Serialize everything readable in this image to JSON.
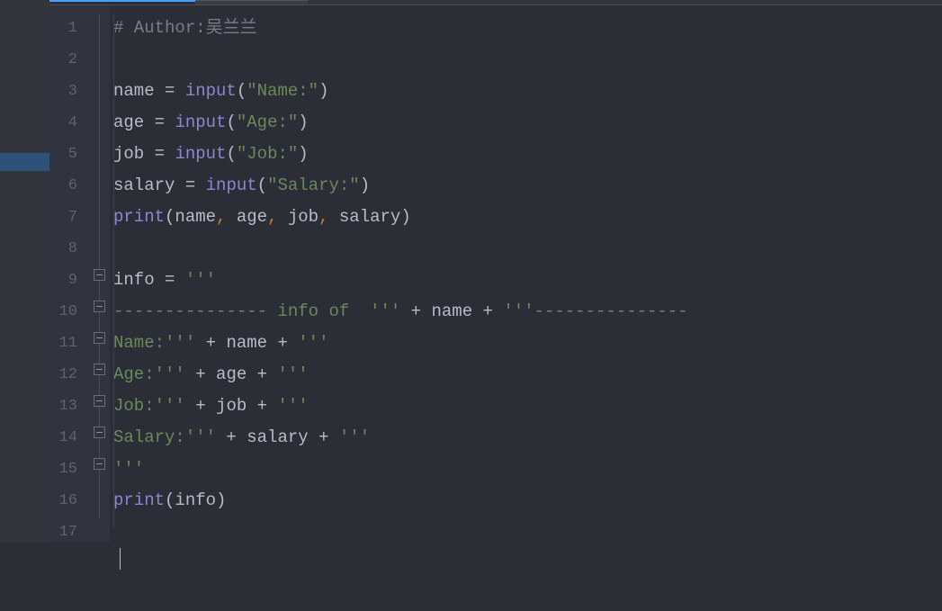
{
  "tabs": {
    "active": "",
    "inactive": ""
  },
  "lineNumbers": [
    "1",
    "2",
    "3",
    "4",
    "5",
    "6",
    "7",
    "8",
    "9",
    "10",
    "11",
    "12",
    "13",
    "14",
    "15",
    "16",
    "17"
  ],
  "code": {
    "line1": {
      "comment": "# Author:吴兰兰"
    },
    "line2": {},
    "line3": {
      "var": "name",
      "op": " = ",
      "fn": "input",
      "p1": "(",
      "str": "\"Name:\"",
      "p2": ")"
    },
    "line4": {
      "var": "age",
      "op": " = ",
      "fn": "input",
      "p1": "(",
      "str": "\"Age:\"",
      "p2": ")"
    },
    "line5": {
      "var": "job",
      "op": " = ",
      "fn": "input",
      "p1": "(",
      "str": "\"Job:\"",
      "p2": ")"
    },
    "line6": {
      "var": "salary",
      "op": " = ",
      "fn": "input",
      "p1": "(",
      "str": "\"Salary:\"",
      "p2": ")"
    },
    "line7": {
      "fn": "print",
      "p1": "(",
      "a1": "name",
      "c1": ",",
      "sp1": " ",
      "a2": "age",
      "c2": ",",
      "sp2": " ",
      "a3": "job",
      "c3": ",",
      "sp3": " ",
      "a4": "salary",
      "p2": ")"
    },
    "line8": {},
    "line9": {
      "var": "info",
      "op": " = ",
      "str": "'''"
    },
    "line10": {
      "s1": "--------------- info of  '''",
      "op1": " + ",
      "v1": "name",
      "op2": " + ",
      "s2": "'''---------------"
    },
    "line11": {
      "s1": "Name:'''",
      "op1": " + ",
      "v1": "name",
      "op2": " + ",
      "s2": "'''"
    },
    "line12": {
      "s1": "Age:'''",
      "op1": " + ",
      "v1": "age",
      "op2": " + ",
      "s2": "'''"
    },
    "line13": {
      "s1": "Job:'''",
      "op1": " + ",
      "v1": "job",
      "op2": " + ",
      "s2": "'''"
    },
    "line14": {
      "s1": "Salary:'''",
      "op1": " + ",
      "v1": "salary",
      "op2": " + ",
      "s2": "'''"
    },
    "line15": {
      "s1": "'''"
    },
    "line16": {
      "fn": "print",
      "p1": "(",
      "a1": "info",
      "p2": ")"
    },
    "line17": {}
  }
}
